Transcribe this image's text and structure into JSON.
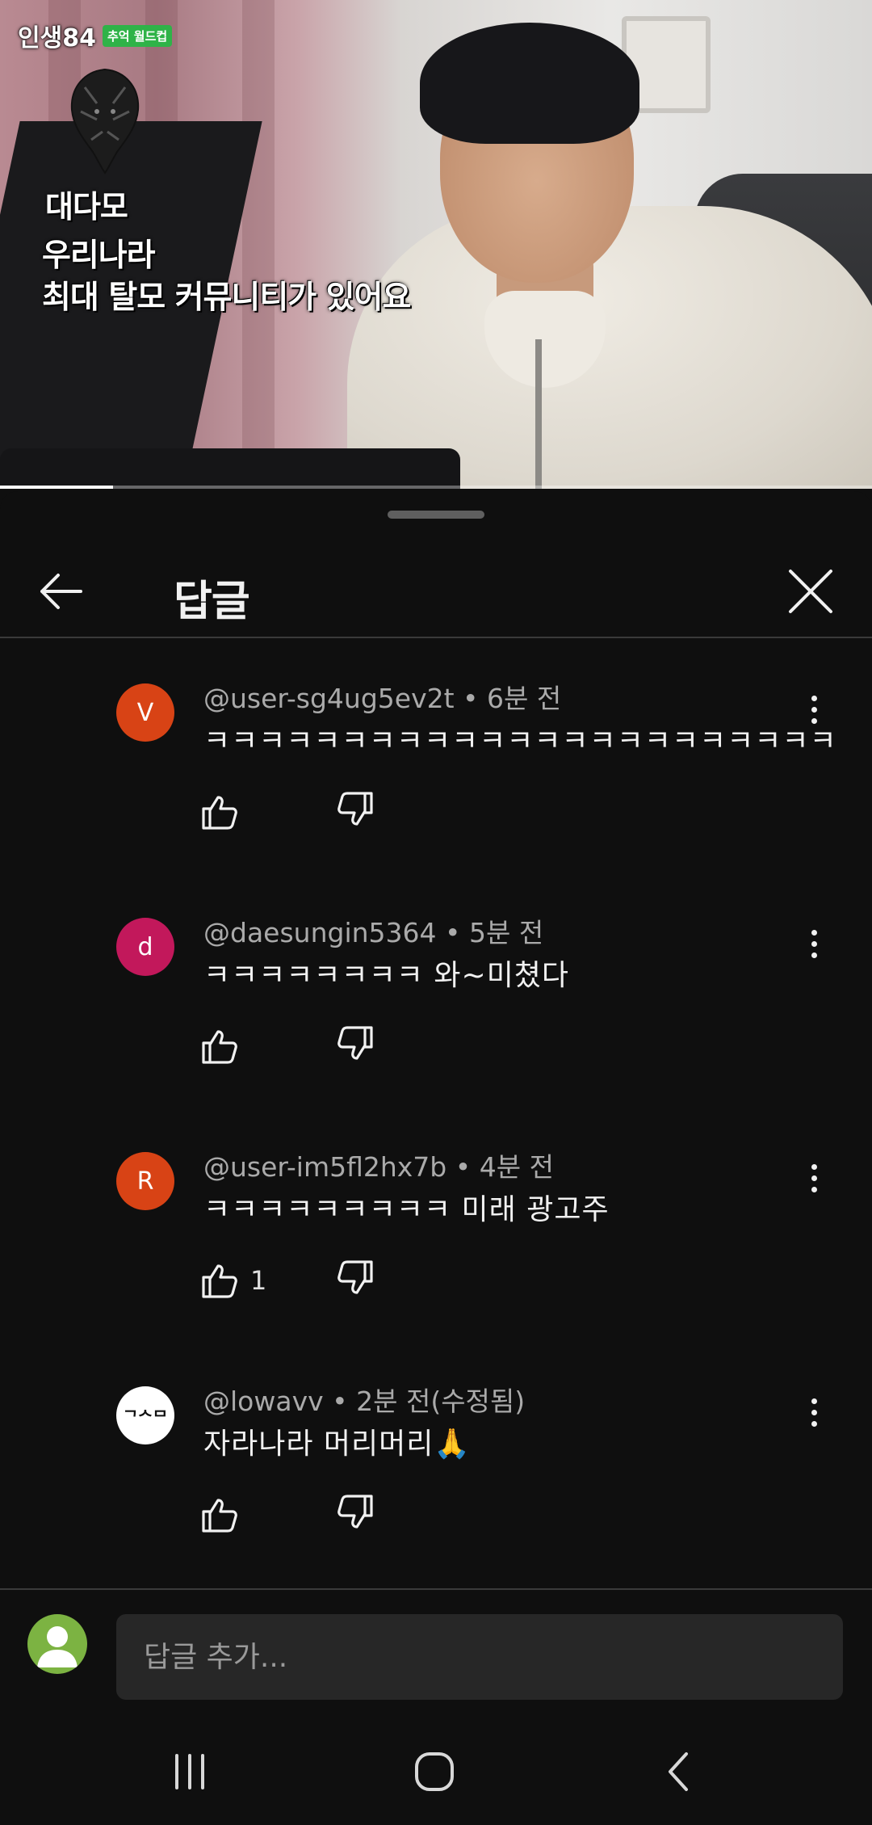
{
  "video": {
    "show_title": "인생84",
    "show_badge": "추억 월드컵",
    "brand": "대다모",
    "caption_line1": "우리나라",
    "caption_line2": "최대 탈모 커뮤니티가 있어요",
    "progress": 0.13
  },
  "sheet": {
    "title": "답글"
  },
  "comments": [
    {
      "author": "@user-sg4ug5ev2t",
      "time": "6분 전",
      "text": "ㅋㅋㅋㅋㅋㅋㅋㅋㅋㅋㅋㅋㅋㅋㅋㅋㅋㅋㅋㅋㅋㅋㅋ",
      "avatar_letter": "V",
      "avatar_color": "#d84315",
      "likes": ""
    },
    {
      "author": "@daesungin5364",
      "time": "5분 전",
      "text": "ㅋㅋㅋㅋㅋㅋㅋㅋ 와~미쳤다",
      "avatar_letter": "d",
      "avatar_color": "#c2185b",
      "likes": ""
    },
    {
      "author": "@user-im5fl2hx7b",
      "time": "4분 전",
      "text": "ㅋㅋㅋㅋㅋㅋㅋㅋㅋ 미래 광고주",
      "avatar_letter": "R",
      "avatar_color": "#d84315",
      "likes": "1"
    },
    {
      "author": "@lowavv",
      "time": "2분 전(수정됨)",
      "text": "자라나라 머리머리🙏",
      "avatar_letter": "ᄀᄉᄆ",
      "avatar_color": "#ffffff",
      "likes": ""
    }
  ],
  "reply": {
    "placeholder": "답글 추가..."
  },
  "colors": {
    "background": "#0f0f0f",
    "text": "#f1f1f1",
    "muted": "#aaaaaa",
    "input_bg": "#272727"
  },
  "icons": [
    "back-arrow-icon",
    "close-icon",
    "more-vert-icon",
    "thumb-up-icon",
    "thumb-down-icon",
    "recents-icon",
    "home-icon",
    "back-nav-icon"
  ]
}
